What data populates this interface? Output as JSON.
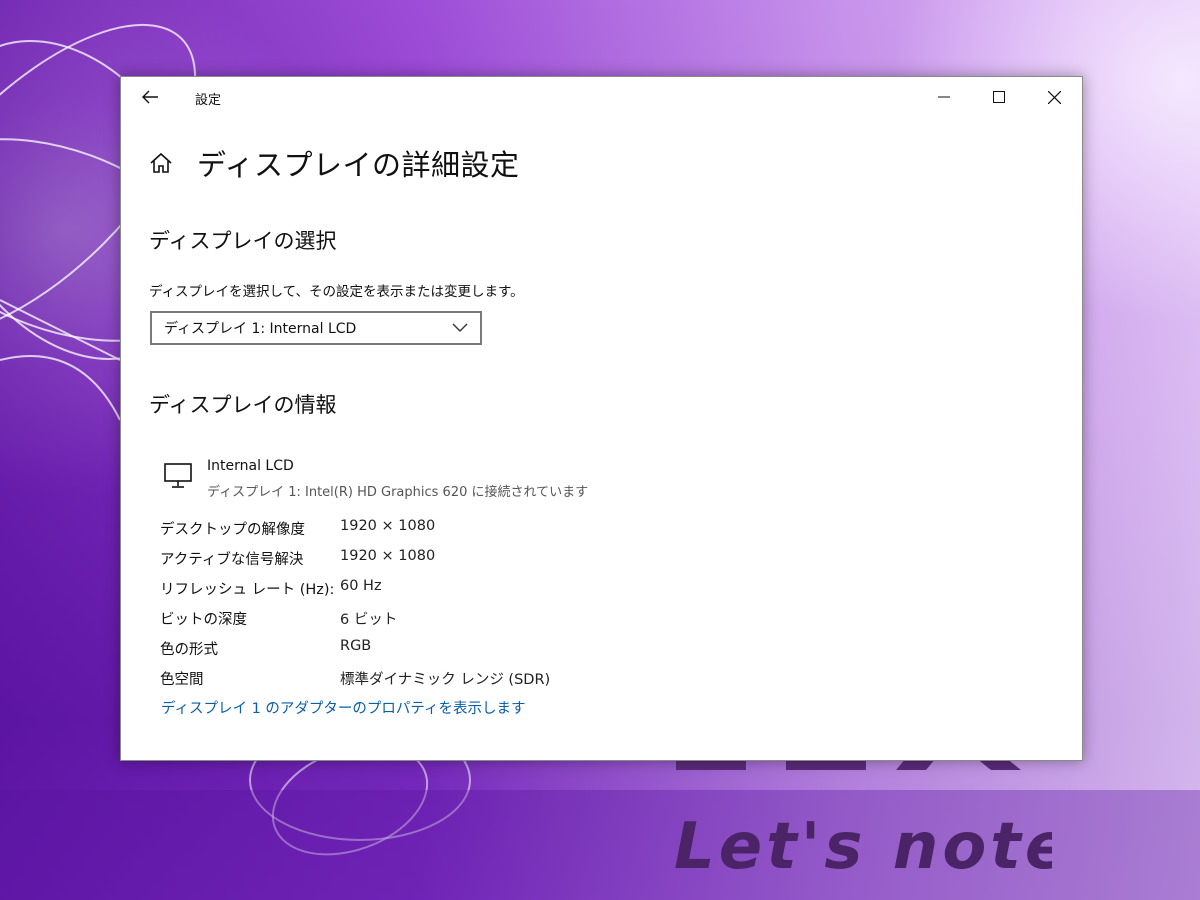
{
  "window": {
    "title": "設定"
  },
  "page": {
    "title": "ディスプレイの詳細設定"
  },
  "select_section": {
    "heading": "ディスプレイの選択",
    "description": "ディスプレイを選択して、その設定を表示または変更します。",
    "selected_display": "ディスプレイ 1: Internal LCD"
  },
  "info_section": {
    "heading": "ディスプレイの情報",
    "display_name": "Internal LCD",
    "connection": "ディスプレイ 1: Intel(R) HD Graphics 620 に接続されています",
    "properties": [
      {
        "label": "デスクトップの解像度",
        "value": "1920 × 1080"
      },
      {
        "label": "アクティブな信号解決",
        "value": "1920 × 1080"
      },
      {
        "label": "リフレッシュ レート (Hz):",
        "value": "60 Hz"
      },
      {
        "label": "ビットの深度",
        "value": "6 ビット"
      },
      {
        "label": "色の形式",
        "value": "RGB"
      },
      {
        "label": "色空間",
        "value": "標準ダイナミック レンジ (SDR)"
      }
    ],
    "adapter_link": "ディスプレイ 1 のアダプターのプロパティを表示します"
  },
  "icons": {
    "back": "back-arrow-icon",
    "home": "home-icon",
    "minimize": "minimize-icon",
    "maximize": "maximize-icon",
    "close": "close-icon",
    "dropdown": "chevron-down-icon",
    "monitor": "monitor-icon"
  },
  "colors": {
    "link": "#0a5fa8",
    "wallpaper_purple": "#8a38c8"
  }
}
